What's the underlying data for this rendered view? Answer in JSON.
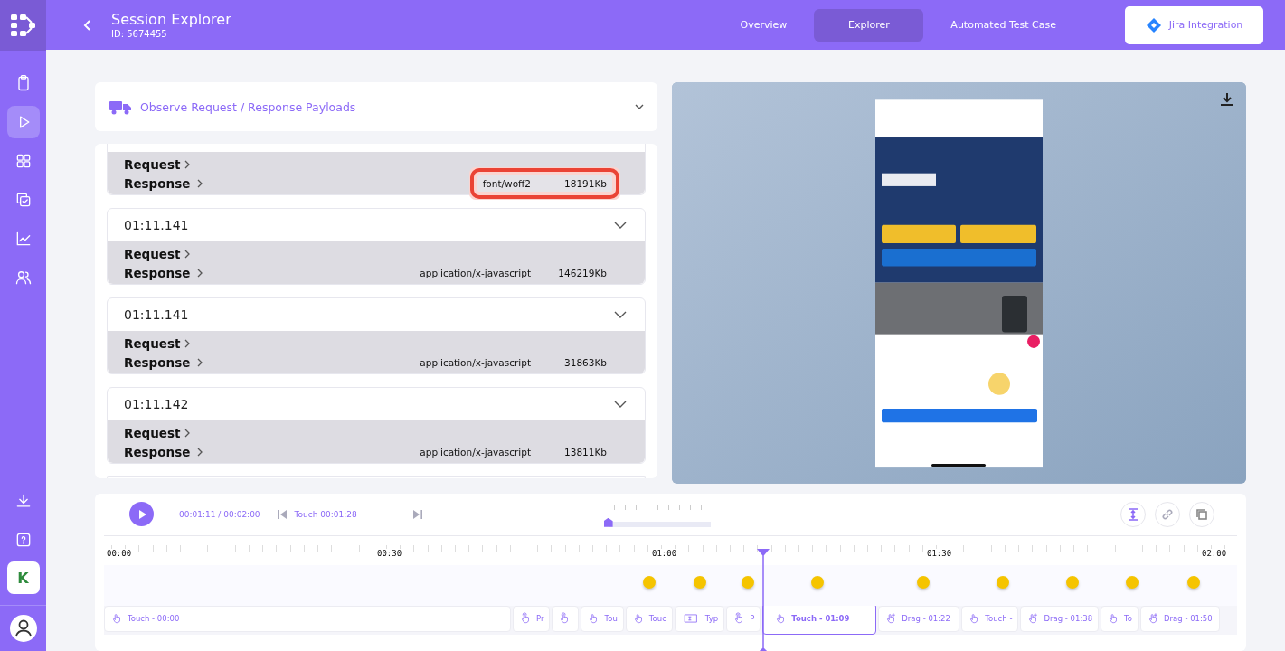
{
  "sidebar": {
    "items": [
      {
        "selected": false
      },
      {
        "selected": true
      },
      {
        "selected": false
      },
      {
        "selected": false
      },
      {
        "selected": false
      },
      {
        "selected": false
      }
    ],
    "badge": "K"
  },
  "header": {
    "title": "Session Explorer",
    "subtitle": "ID: 5674455",
    "tabs": [
      {
        "label": "Overview",
        "selected": false
      },
      {
        "label": "Explorer",
        "selected": true
      },
      {
        "label": "Automated Test Case",
        "selected": false
      }
    ],
    "integration_button": "Jira Integration"
  },
  "payloads": {
    "title": "Observe Request / Response Payloads",
    "entries": [
      {
        "request": "Request",
        "response": "Response",
        "type": "font/woff2",
        "size": "18191Kb",
        "highlighted": true
      },
      {
        "time": "01:11.141",
        "request": "Request",
        "response": "Response",
        "type": "application/x-javascript",
        "size": "146219Kb",
        "highlighted": false
      },
      {
        "time": "01:11.141",
        "request": "Request",
        "response": "Response",
        "type": "application/x-javascript",
        "size": "31863Kb",
        "highlighted": false
      },
      {
        "time": "01:11.142",
        "request": "Request",
        "response": "Response",
        "type": "application/x-javascript",
        "size": "13811Kb",
        "highlighted": false
      }
    ]
  },
  "timeline": {
    "play_time": "00:01:11 / 00:02:00",
    "current_event": "Touch 00:01:28",
    "zoom": {
      "level": 0
    },
    "ruler": [
      "00:00",
      "00:30",
      "01:00",
      "01:30",
      "02:00"
    ],
    "events": [
      {
        "kind": "touch",
        "label": "Touch - 00:00",
        "selected": false
      },
      {
        "kind": "press",
        "label": "Pr",
        "selected": false
      },
      {
        "kind": "press",
        "selected": false
      },
      {
        "kind": "touch",
        "label": "Tou",
        "selected": false
      },
      {
        "kind": "touch",
        "label": "Touc",
        "selected": false
      },
      {
        "kind": "type",
        "label": "Typ",
        "selected": false
      },
      {
        "kind": "press",
        "label": "P",
        "selected": false
      },
      {
        "kind": "touch",
        "label": "Touch - 01:09",
        "selected": true
      },
      {
        "kind": "drag",
        "label": "Drag - 01:22",
        "selected": false
      },
      {
        "kind": "touch",
        "label": "Touch -",
        "selected": false
      },
      {
        "kind": "drag",
        "label": "Drag - 01:38",
        "selected": false
      },
      {
        "kind": "touch",
        "label": "To",
        "selected": false
      },
      {
        "kind": "drag",
        "label": "Drag - 01:50",
        "selected": false
      }
    ]
  }
}
